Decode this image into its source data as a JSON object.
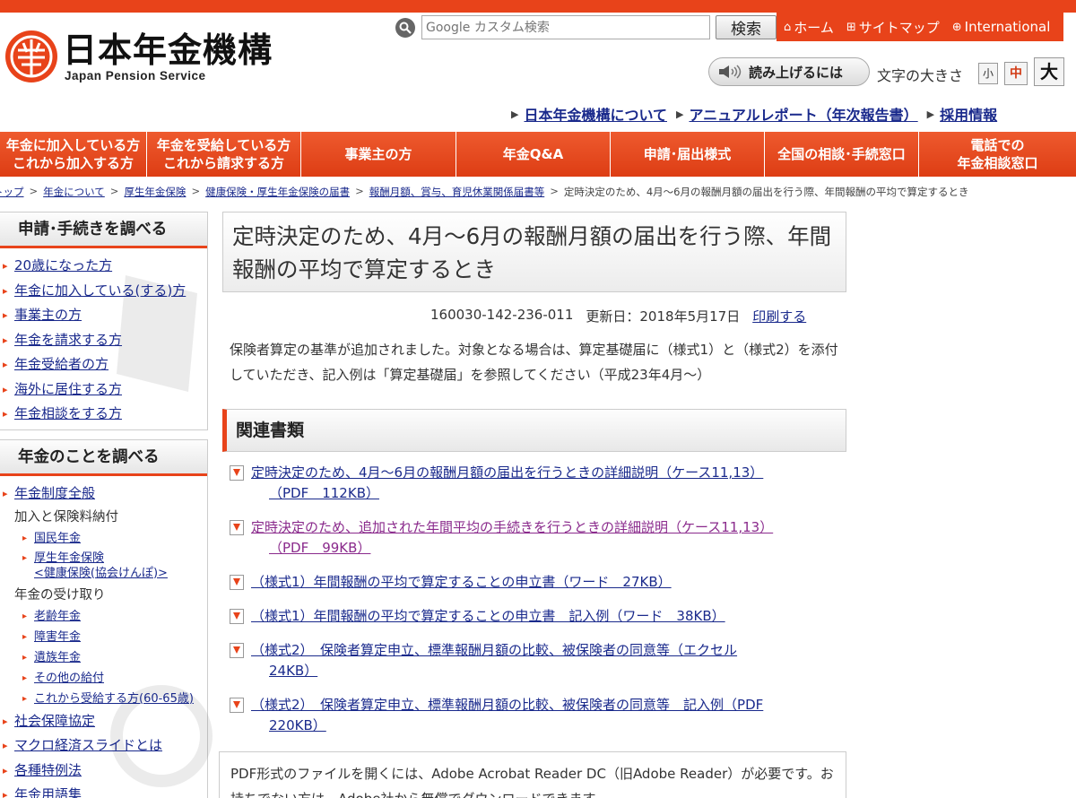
{
  "header": {
    "logo_jp": "日本年金機構",
    "logo_en": "Japan Pension Service",
    "search_placeholder": "Google カスタム検索",
    "search_button": "検索",
    "util_nav": [
      {
        "label": "ホーム",
        "icon": "home-icon"
      },
      {
        "label": "サイトマップ",
        "icon": "sitemap-icon"
      },
      {
        "label": "International",
        "icon": "globe-icon"
      }
    ],
    "read_aloud": "読み上げるには",
    "font_size_label": "文字の大きさ",
    "font_sizes": {
      "small": "小",
      "medium": "中",
      "large": "大"
    },
    "sub_links": [
      "日本年金機構について",
      "アニュアルレポート（年次報告書）",
      "採用情報"
    ]
  },
  "global_nav": [
    "年金に加入している方\nこれから加入する方",
    "年金を受給している方\nこれから請求する方",
    "事業主の方",
    "年金Q&A",
    "申請･届出様式",
    "全国の相談･手続窓口",
    "電話での\n年金相談窓口"
  ],
  "breadcrumb": [
    "トップ",
    "年金について",
    "厚生年金保険",
    "健康保険・厚生年金保険の届書",
    "報酬月額、賞与、育児休業関係届書等",
    "定時決定のため、4月～6月の報酬月額の届出を行う際、年間報酬の平均で算定するとき"
  ],
  "sidebar": {
    "procedures_title": "申請･手続きを調べる",
    "procedures": [
      "20歳になった方",
      "年金に加入している(する)方",
      "事業主の方",
      "年金を請求する方",
      "年金受給者の方",
      "海外に居住する方",
      "年金相談をする方"
    ],
    "pension_title": "年金のことを調べる",
    "pension_system": "年金制度全般",
    "group1_label": "加入と保険料納付",
    "group1": [
      "国民年金",
      "厚生年金保険\n<健康保険(協会けんぽ)>"
    ],
    "group2_label": "年金の受け取り",
    "group2": [
      "老齢年金",
      "障害年金",
      "遺族年金",
      "その他の給付",
      "これから受給する方(60-65歳)"
    ],
    "more": [
      "社会保障協定",
      "マクロ経済スライドとは",
      "各種特例法",
      "年金用語集"
    ]
  },
  "main": {
    "title": "定時決定のため、4月～6月の報酬月額の届出を行う際、年間報酬の平均で算定するとき",
    "doc_id": "160030-142-236-011",
    "updated": "更新日：2018年5月17日",
    "print": "印刷する",
    "intro": "保険者算定の基準が追加されました。対象となる場合は、算定基礎届に（様式1）と（様式2）を添付していただき、記入例は「算定基礎届」を参照してください（平成23年4月～）",
    "related_title": "関連書類",
    "documents": [
      {
        "label": "定時決定のため、4月～6月の報酬月額の届出を行うときの詳細説明（ケース11,13）",
        "size": "（PDF　112KB）"
      },
      {
        "label": "定時決定のため、追加された年間平均の手続きを行うときの詳細説明（ケース11,13）",
        "size": "（PDF　99KB）"
      },
      {
        "label": "（様式1）年間報酬の平均で算定することの申立書（ワード　27KB）",
        "size": ""
      },
      {
        "label": "（様式1）年間報酬の平均で算定することの申立書　記入例（ワード　38KB）",
        "size": ""
      },
      {
        "label": "（様式2）　保険者算定申立、標準報酬月額の比較、被保険者の同意等（エクセル",
        "size": "24KB）"
      },
      {
        "label": "（様式2）　保険者算定申立、標準報酬月額の比較、被保険者の同意等　記入例（PDF",
        "size": "220KB）"
      }
    ],
    "note": "PDF形式のファイルを開くには、Adobe Acrobat Reader DC（旧Adobe Reader）が必要です。お持ちでない方は、Adobe社から無償でダウンロードできます。"
  },
  "colors": {
    "accent": "#e8431a",
    "link": "#1a2a8c",
    "visited": "#8a2a8c"
  }
}
